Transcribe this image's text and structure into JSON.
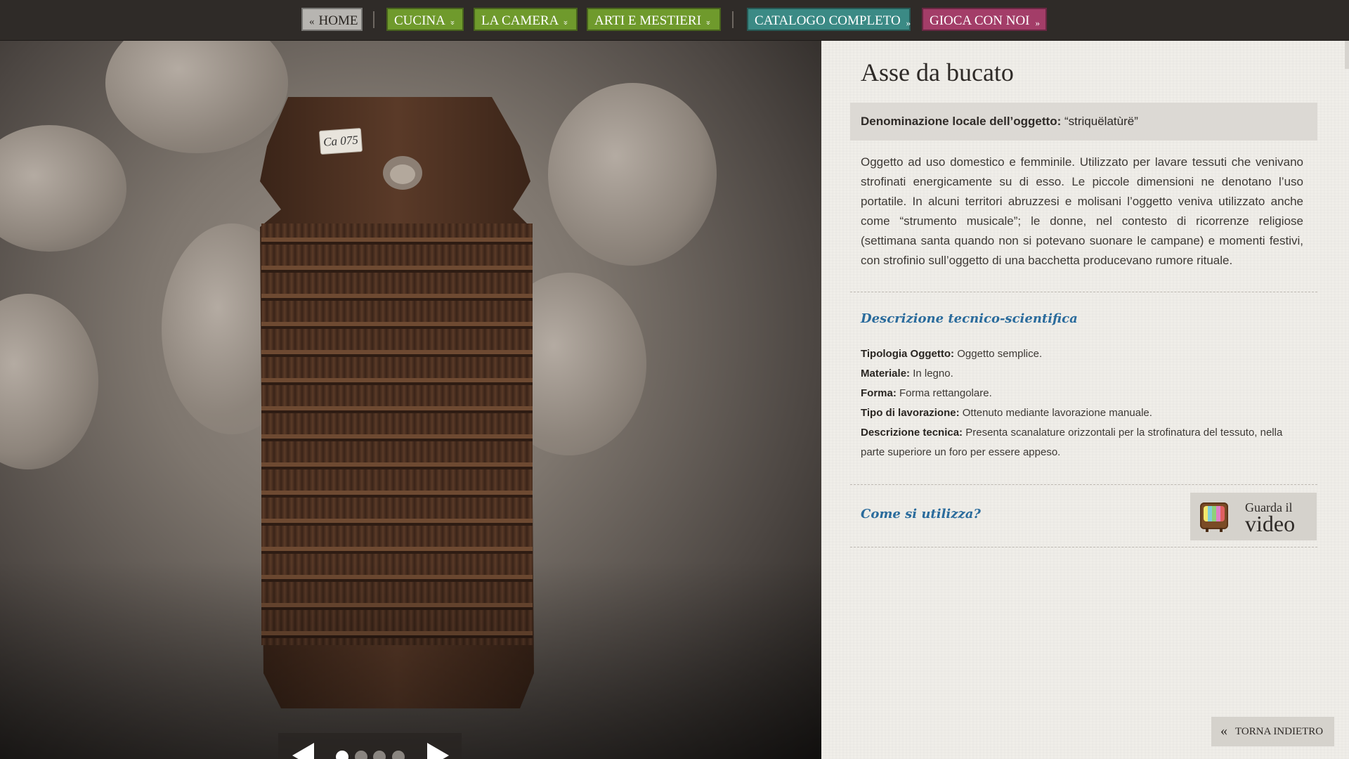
{
  "nav": {
    "home": "HOME",
    "home_prefix": "«",
    "cucina": "CUCINA",
    "camera": "LA CAMERA",
    "arti": "ARTI E MESTIERI",
    "catalogo": "CATALOGO COMPLETO",
    "gioca": "GIOCA CON NOI",
    "dropdown_arrow": "»",
    "link_arrow": "»"
  },
  "photo": {
    "tag_text": "Ca 075",
    "slides_total": 4,
    "active_slide": 1
  },
  "content": {
    "title": "Asse da bucato",
    "local_name_label": "Denominazione locale dell’oggetto:",
    "local_name_value": "“striquëlatùrë”",
    "description": "Oggetto ad uso domestico e femminile. Utilizzato per lavare tessuti che venivano strofinati energicamente su di esso. Le piccole dimensioni ne denotano l’uso portatile. In alcuni territori abruzzesi e molisani l’oggetto veniva utilizzato anche come “strumento musicale”; le donne, nel contesto di ricorrenze religiose (settimana santa quando non si potevano suonare le campane) e momenti festivi, con strofinio sull’oggetto di una bacchetta producevano rumore rituale.",
    "tech_heading": "Descrizione tecnico-scientifica",
    "specs": [
      {
        "label": "Tipologia Oggetto:",
        "value": "Oggetto semplice."
      },
      {
        "label": "Materiale:",
        "value": "In legno."
      },
      {
        "label": "Forma:",
        "value": "Forma rettangolare."
      },
      {
        "label": "Tipo di lavorazione:",
        "value": "Ottenuto mediante lavorazione manuale."
      },
      {
        "label": "Descrizione tecnica:",
        "value": "Presenta scanalature orizzontali per la strofinatura del tessuto, nella parte superiore un foro per essere appeso."
      }
    ],
    "usage_heading": "Come si utilizza?",
    "video_line1": "Guarda il",
    "video_line2": "video",
    "back_label": "TORNA INDIETRO",
    "back_icon": "«"
  },
  "colors": {
    "nav_home": "#b7b5b1",
    "nav_green": "#6f9a2c",
    "nav_teal": "#3b8a85",
    "nav_pink": "#a33d68",
    "heading_blue": "#2a6b9c",
    "panel_bg": "#f0eee9"
  }
}
